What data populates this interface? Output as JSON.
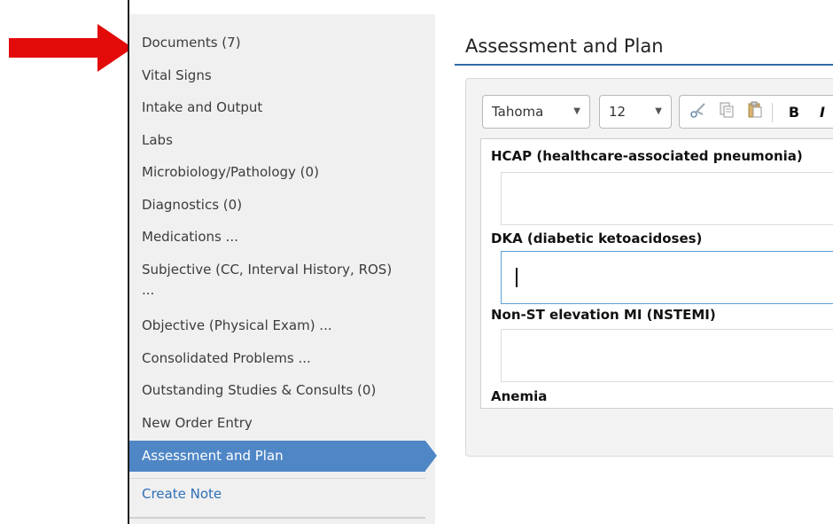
{
  "sidebar": {
    "items": [
      {
        "label": "Documents (7)"
      },
      {
        "label": "Vital Signs"
      },
      {
        "label": "Intake and Output"
      },
      {
        "label": "Labs"
      },
      {
        "label": "Microbiology/Pathology (0)"
      },
      {
        "label": "Diagnostics (0)"
      },
      {
        "label": "Medications ..."
      },
      {
        "label": "Subjective (CC, Interval History, ROS) ..."
      },
      {
        "label": "Objective (Physical Exam) ..."
      },
      {
        "label": "Consolidated Problems ..."
      },
      {
        "label": "Outstanding Studies & Consults (0)"
      },
      {
        "label": "New Order Entry"
      },
      {
        "label": "Assessment and Plan"
      }
    ],
    "active": "Assessment and Plan",
    "create_note": "Create Note"
  },
  "main": {
    "title": "Assessment and Plan",
    "toolbar": {
      "font": "Tahoma",
      "size": "12",
      "icons": [
        "scissors-icon",
        "copy-icon",
        "paste-icon",
        "bold-icon",
        "italic-icon"
      ],
      "bold_label": "B",
      "italic_label": "I"
    },
    "sections": [
      {
        "label": "HCAP (healthcare-associated pneumonia)"
      },
      {
        "label": "DKA (diabetic ketoacidoses)"
      },
      {
        "label": "Non-ST elevation MI (NSTEMI)"
      },
      {
        "label": "Anemia"
      }
    ]
  },
  "colors": {
    "accent": "#4f86c6",
    "title_rule": "#2e6ca8",
    "arrow": "#e30a0a",
    "sidebar_bg": "#f0f0f0",
    "link": "#2f6fb8"
  }
}
